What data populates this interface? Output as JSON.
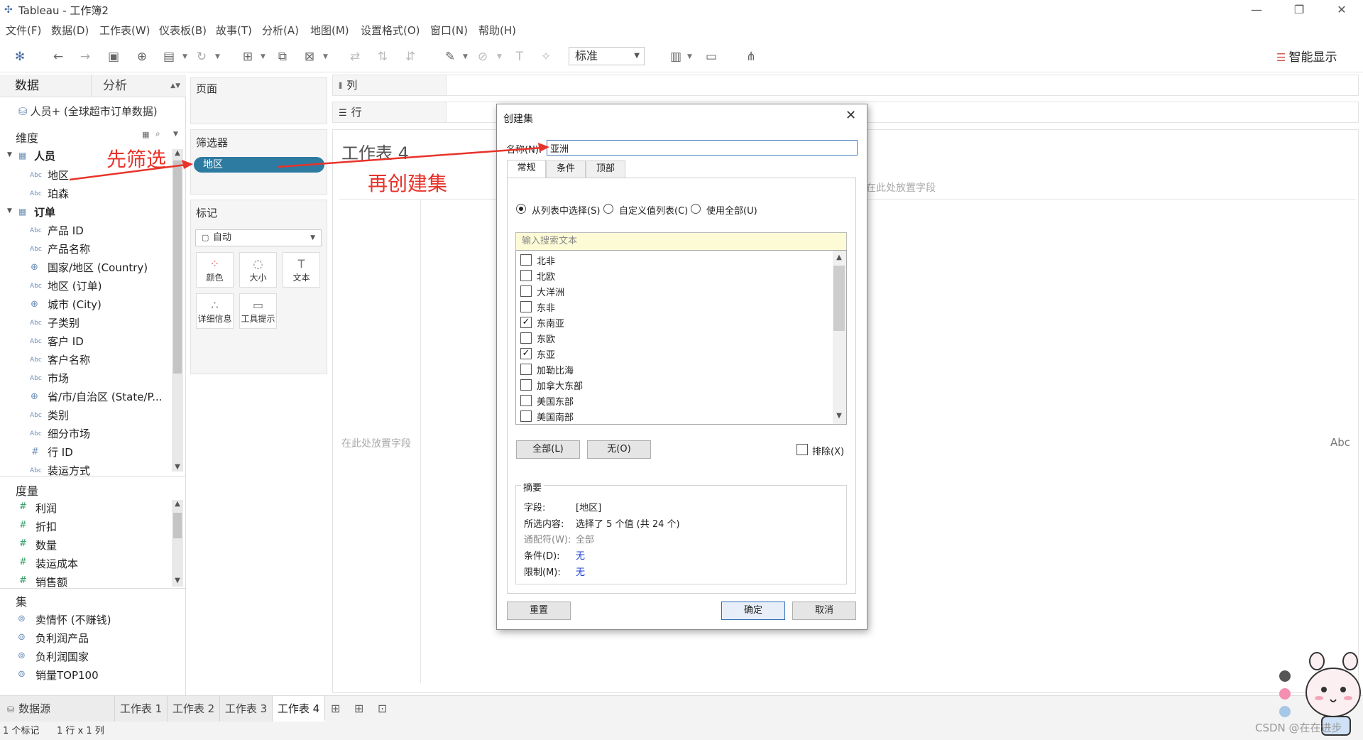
{
  "window": {
    "title": "Tableau - 工作簿2",
    "minimize": "—",
    "restore": "❐",
    "close": "✕"
  },
  "menu": [
    "文件(F)",
    "数据(D)",
    "工作表(W)",
    "仪表板(B)",
    "故事(T)",
    "分析(A)",
    "地图(M)",
    "设置格式(O)",
    "窗口(N)",
    "帮助(H)"
  ],
  "toolbar": {
    "fit_select": "标准",
    "smart_show": "智能显示"
  },
  "data_pane": {
    "tab_data": "数据",
    "tab_analysis": "分析",
    "datasource": "人员+ (全球超市订单数据)",
    "dimensions_header": "维度",
    "groups": [
      {
        "name": "人员",
        "fields": [
          {
            "type": "Abc",
            "name": "地区"
          },
          {
            "type": "Abc",
            "name": "珀森"
          }
        ]
      },
      {
        "name": "订单",
        "fields": [
          {
            "type": "Abc",
            "name": "产品 ID"
          },
          {
            "type": "Abc",
            "name": "产品名称"
          },
          {
            "type": "globe",
            "name": "国家/地区 (Country)"
          },
          {
            "type": "Abc",
            "name": "地区 (订单)"
          },
          {
            "type": "globe",
            "name": "城市 (City)"
          },
          {
            "type": "Abc",
            "name": "子类别"
          },
          {
            "type": "Abc",
            "name": "客户 ID"
          },
          {
            "type": "Abc",
            "name": "客户名称"
          },
          {
            "type": "Abc",
            "name": "市场"
          },
          {
            "type": "globe",
            "name": "省/市/自治区 (State/P..."
          },
          {
            "type": "Abc",
            "name": "类别"
          },
          {
            "type": "Abc",
            "name": "细分市场"
          },
          {
            "type": "#",
            "name": "行 ID"
          },
          {
            "type": "Abc",
            "name": "装运方式"
          }
        ]
      }
    ],
    "measures_header": "度量",
    "measures": [
      "利润",
      "折扣",
      "数量",
      "装运成本",
      "销售额"
    ],
    "sets_header": "集",
    "sets": [
      "卖情怀 (不赚钱)",
      "负利润产品",
      "负利润国家",
      "销量TOP100"
    ]
  },
  "cards": {
    "pages": "页面",
    "filters": "筛选器",
    "filter_pill": "地区",
    "marks": "标记",
    "mark_type": "自动",
    "mark_buttons": [
      {
        "label": "颜色",
        "icon": "color-icon"
      },
      {
        "label": "大小",
        "icon": "size-icon"
      },
      {
        "label": "文本",
        "icon": "text-icon"
      },
      {
        "label": "详细信息",
        "icon": "detail-icon"
      },
      {
        "label": "工具提示",
        "icon": "tooltip-icon"
      }
    ]
  },
  "shelves": {
    "columns": "列",
    "rows": "行"
  },
  "canvas": {
    "sheet_title": "工作表 4",
    "drop_hint_top": "在此处放置字段",
    "drop_hint_left": "在此处放置字段",
    "abc": "Abc"
  },
  "bottom": {
    "datasource_tab": "数据源",
    "sheets": [
      "工作表 1",
      "工作表 2",
      "工作表 3",
      "工作表 4"
    ],
    "status_marks": "1 个标记",
    "status_dims": "1 行 x 1 列"
  },
  "dialog": {
    "title": "创建集",
    "name_label": "名称(N):",
    "name_value": "亚洲",
    "tabs": [
      "常规",
      "条件",
      "顶部"
    ],
    "radio_list": "从列表中选择(S)",
    "radio_custom": "自定义值列表(C)",
    "radio_all": "使用全部(U)",
    "search_placeholder": "输入搜索文本",
    "items": [
      {
        "label": "北非",
        "checked": false
      },
      {
        "label": "北欧",
        "checked": false
      },
      {
        "label": "大洋洲",
        "checked": false
      },
      {
        "label": "东非",
        "checked": false
      },
      {
        "label": "东南亚",
        "checked": true
      },
      {
        "label": "东欧",
        "checked": false
      },
      {
        "label": "东亚",
        "checked": true
      },
      {
        "label": "加勒比海",
        "checked": false
      },
      {
        "label": "加拿大东部",
        "checked": false
      },
      {
        "label": "美国东部",
        "checked": false
      },
      {
        "label": "美国南部",
        "checked": false
      }
    ],
    "btn_all": "全部(L)",
    "btn_none": "无(O)",
    "exclude": "排除(X)",
    "summary_title": "摘要",
    "summary": {
      "field_label": "字段:",
      "field_value": "[地区]",
      "selected_label": "所选内容:",
      "selected_value": "选择了 5 个值 (共 24 个)",
      "wildcard_label": "通配符(W):",
      "wildcard_value": "全部",
      "condition_label": "条件(D):",
      "condition_value": "无",
      "limit_label": "限制(M):",
      "limit_value": "无"
    },
    "btn_reset": "重置",
    "btn_ok": "确定",
    "btn_cancel": "取消",
    "close": "✕"
  },
  "annotations": {
    "first": "先筛选",
    "second": "再创建集"
  },
  "watermark": "CSDN @在在进步"
}
